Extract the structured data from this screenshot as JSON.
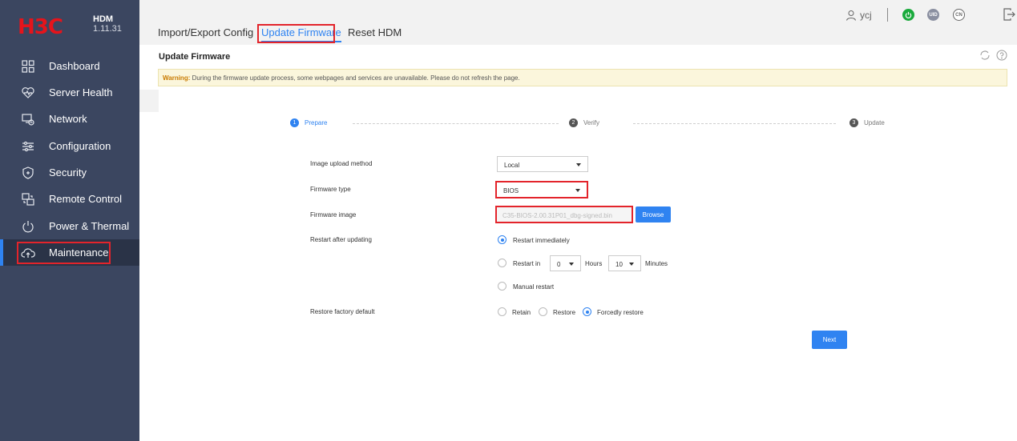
{
  "logo": {
    "mark": "H3C",
    "name": "HDM",
    "version": "1.11.31"
  },
  "sidebar": {
    "items": [
      {
        "label": "Dashboard",
        "icon": "dashboard-icon"
      },
      {
        "label": "Server Health",
        "icon": "heart-icon"
      },
      {
        "label": "Network",
        "icon": "network-icon"
      },
      {
        "label": "Configuration",
        "icon": "sliders-icon"
      },
      {
        "label": "Security",
        "icon": "shield-icon"
      },
      {
        "label": "Remote Control",
        "icon": "remote-icon"
      },
      {
        "label": "Power & Thermal",
        "icon": "power-icon"
      },
      {
        "label": "Maintenance",
        "icon": "cloud-upload-icon",
        "active": true
      }
    ]
  },
  "tabs": [
    {
      "label": "Import/Export Config"
    },
    {
      "label": "Update Firmware",
      "active": true
    },
    {
      "label": "Reset HDM"
    }
  ],
  "header": {
    "user": "ycj",
    "status_icons": [
      {
        "name": "power-status-icon",
        "text": "",
        "color": "#1aaa3c"
      },
      {
        "name": "uid-icon",
        "text": "UID",
        "color": "#8a8fa0"
      },
      {
        "name": "language-icon",
        "text": "CN",
        "color": "#666666"
      }
    ]
  },
  "panel": {
    "title": "Update Firmware",
    "warning_label": "Warning:",
    "warning_text": " During the firmware update process, some webpages and services are unavailable. Please do not refresh the page."
  },
  "steps": [
    {
      "num": "1",
      "label": "Prepare",
      "current": true
    },
    {
      "num": "2",
      "label": "Verify"
    },
    {
      "num": "3",
      "label": "Update"
    }
  ],
  "form": {
    "upload_method": {
      "label": "Image upload method",
      "value": "Local"
    },
    "firmware_type": {
      "label": "Firmware type",
      "value": "BIOS"
    },
    "firmware_image": {
      "label": "Firmware image",
      "value": "C35-BIOS-2.00.31P01_dbg-signed.bin",
      "browse": "Browse"
    },
    "restart": {
      "label": "Restart after updating",
      "immediately": "Restart immediately",
      "restart_in": "Restart in",
      "hours_value": "0",
      "hours_label": "Hours",
      "minutes_value": "10",
      "minutes_label": "Minutes",
      "manual": "Manual restart"
    },
    "restore": {
      "label": "Restore factory default",
      "retain": "Retain",
      "restore": "Restore",
      "forcedly": "Forcedly restore"
    },
    "next": "Next"
  },
  "colors": {
    "sidebar": "#3b4660",
    "accent": "#2f83f1",
    "highlight": "#e3242b",
    "warning_bg": "#fbf6dc"
  }
}
